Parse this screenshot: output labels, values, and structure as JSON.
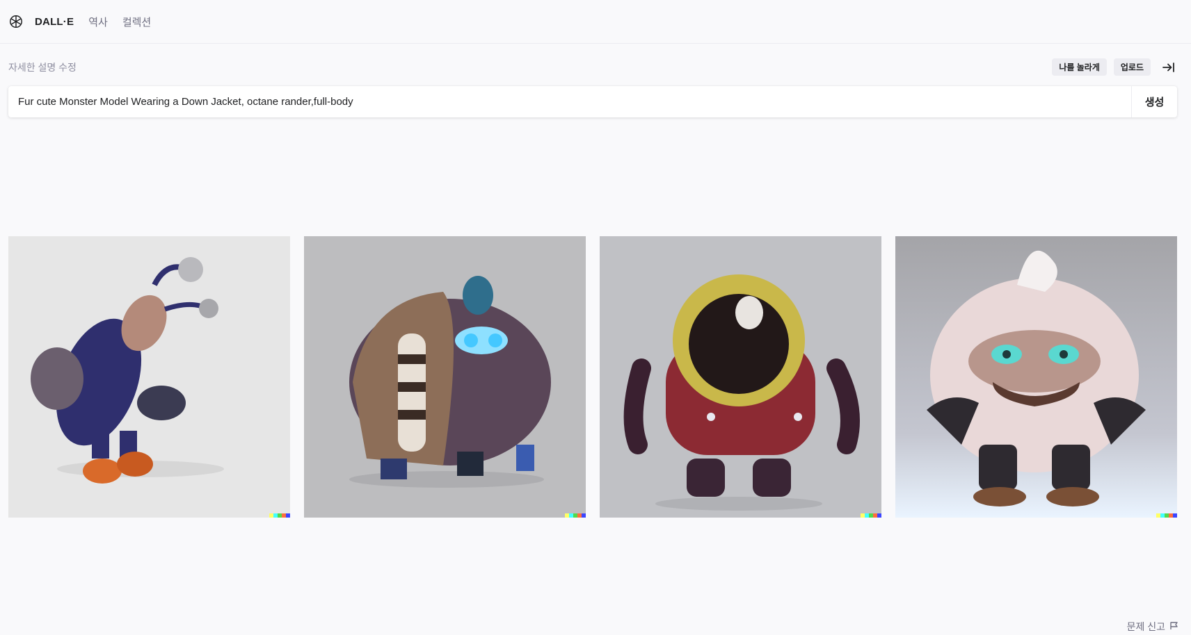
{
  "header": {
    "logo_icon": "openai-logo-icon",
    "nav": [
      {
        "label": "DALL·E"
      },
      {
        "label": "역사"
      },
      {
        "label": "컬렉션"
      }
    ]
  },
  "prompt": {
    "label": "자세한 설명 수정",
    "actions": {
      "surprise_label": "나를 놀라게",
      "upload_label": "업로드",
      "collapse_icon": "arrow-right-to-bar-icon"
    },
    "value": "Fur cute Monster Model Wearing a Down Jacket, octane rander,full-body",
    "generate_label": "생성"
  },
  "results": [
    {
      "background": "#e4e4e4",
      "subject_color": "#2f2f6e"
    },
    {
      "background": "#bdbdbf",
      "subject_color": "#4a3a4a"
    },
    {
      "background": "#bfc0c4",
      "subject_color": "#8c2a33"
    },
    {
      "background": "#a7a7ab",
      "subject_color": "#e8d6d6"
    }
  ],
  "watermark_colors": [
    "#ffff66",
    "#42ffff",
    "#51da4c",
    "#ff6e3c",
    "#3c46ff"
  ],
  "footer": {
    "report_label": "문제 신고",
    "report_icon": "flag-icon"
  }
}
